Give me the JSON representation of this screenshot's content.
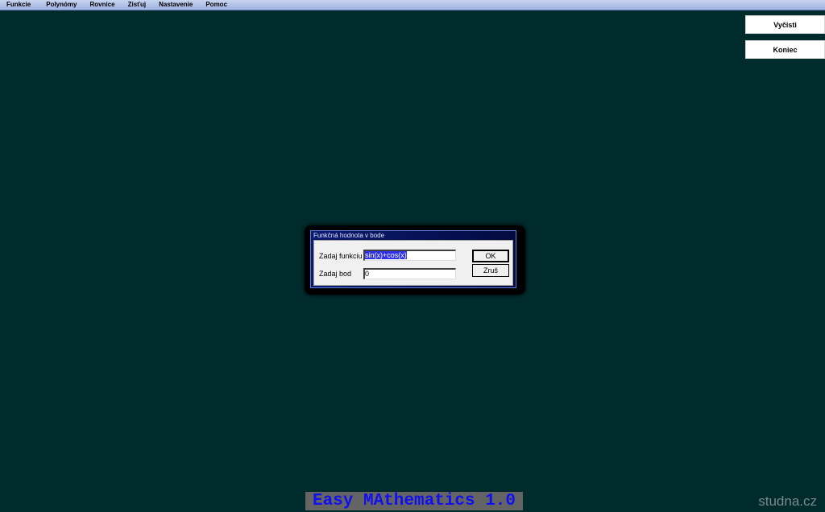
{
  "menu": [
    "Funkcie",
    "Polynómy",
    "Rovnice",
    "Zisťuj",
    "Nastavenie",
    "Pomoc"
  ],
  "side_buttons": {
    "clear": "Vyčisti",
    "exit": "Koniec"
  },
  "dialog": {
    "title": "Funkčná hodnota v bode",
    "function_label": "Zadaj funkciu",
    "function_value": "sin(x)+cos(x)",
    "point_label": "Zadaj bod",
    "point_value": "0",
    "ok": "OK",
    "cancel": "Zruš"
  },
  "app_title": "Easy MAthematics 1.0",
  "watermark": "studna.cz"
}
